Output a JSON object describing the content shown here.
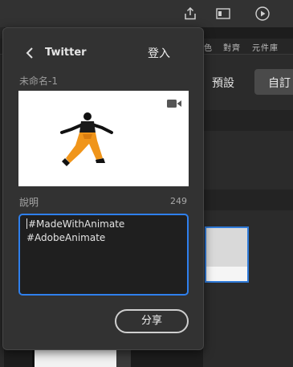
{
  "background": {
    "panel_tabs": [
      "色",
      "對齊",
      "元件庫"
    ],
    "preset_label": "預設",
    "custom_button_label": "自訂",
    "topbar_icons": [
      "share-icon",
      "panel-icon",
      "play-icon"
    ]
  },
  "dialog": {
    "title": "Twitter",
    "login_label": "登入",
    "document_name": "未命名-1",
    "caption_label": "說明",
    "caption_remaining": "249",
    "caption_text": "#MadeWithAnimate\n#AdobeAnimate",
    "share_label": "分享"
  },
  "colors": {
    "accent": "#2f80ed",
    "dialog_bg": "#323232",
    "figure_pants": "#f0951a"
  }
}
